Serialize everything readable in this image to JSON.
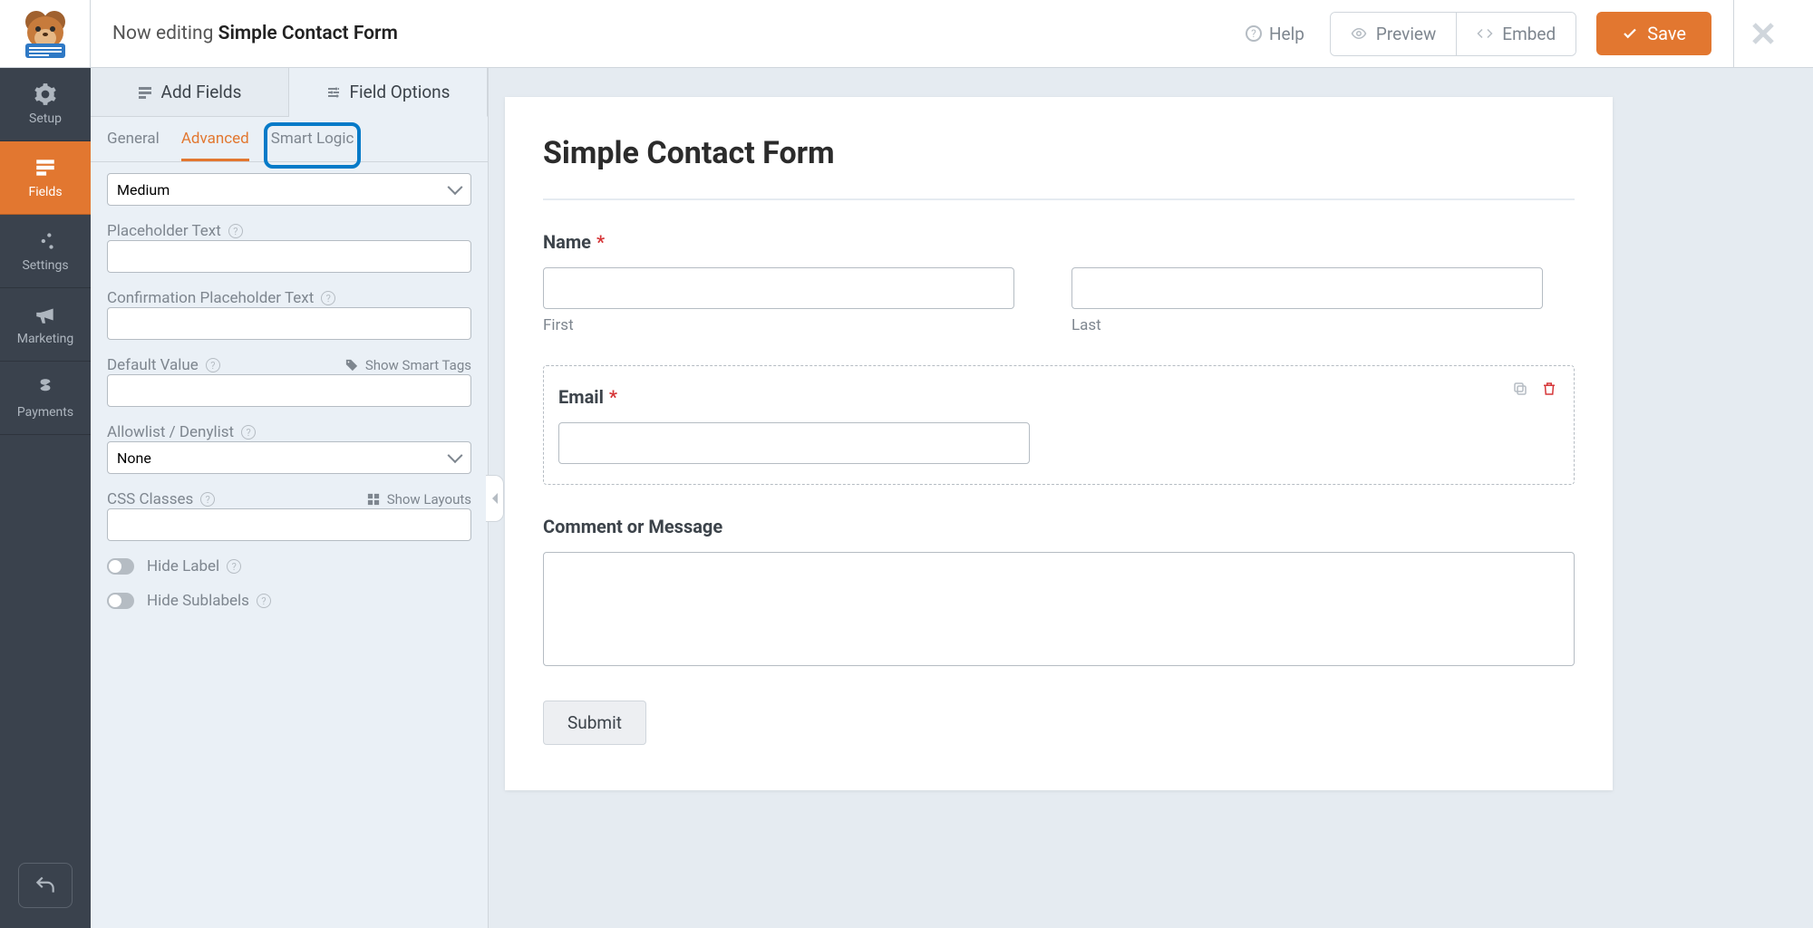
{
  "header": {
    "editing_prefix": "Now editing",
    "form_name": "Simple Contact Form",
    "help": "Help",
    "preview": "Preview",
    "embed": "Embed",
    "save": "Save"
  },
  "rail": {
    "setup": "Setup",
    "fields": "Fields",
    "settings": "Settings",
    "marketing": "Marketing",
    "payments": "Payments"
  },
  "sidebar": {
    "main_tabs": {
      "add": "Add Fields",
      "options": "Field Options"
    },
    "sub_tabs": {
      "general": "General",
      "advanced": "Advanced",
      "smart_logic": "Smart Logic"
    },
    "size_value": "Medium",
    "placeholder_label": "Placeholder Text",
    "confirm_placeholder_label": "Confirmation Placeholder Text",
    "default_value_label": "Default Value",
    "show_smart_tags": "Show Smart Tags",
    "allowlist_label": "Allowlist / Denylist",
    "allowlist_value": "None",
    "css_label": "CSS Classes",
    "show_layouts": "Show Layouts",
    "hide_label": "Hide Label",
    "hide_sublabels": "Hide Sublabels"
  },
  "preview": {
    "title": "Simple Contact Form",
    "name_label": "Name",
    "first_sub": "First",
    "last_sub": "Last",
    "email_label": "Email",
    "comment_label": "Comment or Message",
    "submit": "Submit",
    "required_mark": "*"
  }
}
